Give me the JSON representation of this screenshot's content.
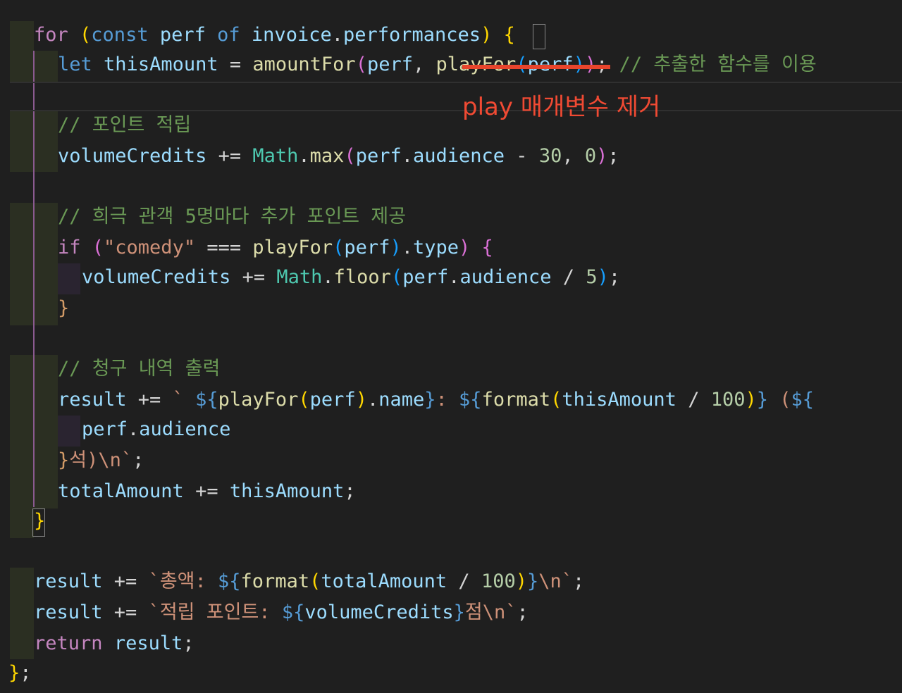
{
  "code": {
    "l1": [
      "for",
      " (",
      "const",
      " ",
      "perf",
      " ",
      "of",
      " ",
      "invoice",
      ".",
      "performances",
      ") ",
      "{"
    ],
    "l2": [
      "let",
      " ",
      "thisAmount",
      " = ",
      "amountFor",
      "(",
      "perf",
      ", ",
      "playFor",
      "(",
      "perf",
      ")",
      ")",
      "; ",
      "// 추출한 함수를 이용"
    ],
    "l3": [
      "// 포인트 적립"
    ],
    "l4": [
      "volumeCredits",
      " += ",
      "Math",
      ".",
      "max",
      "(",
      "perf",
      ".",
      "audience",
      " - ",
      "30",
      ", ",
      "0",
      ")",
      ";"
    ],
    "l5": [
      "// 희극 관객 5명마다 추가 포인트 제공"
    ],
    "l6": [
      "if",
      " (",
      "\"comedy\"",
      " === ",
      "playFor",
      "(",
      "perf",
      ")",
      ".",
      "type",
      ") ",
      "{"
    ],
    "l7": [
      "volumeCredits",
      " += ",
      "Math",
      ".",
      "floor",
      "(",
      "perf",
      ".",
      "audience",
      " / ",
      "5",
      ")",
      ";"
    ],
    "l8": [
      "}"
    ],
    "l9": [
      "// 청구 내역 출력"
    ],
    "l10": [
      "result",
      " += ",
      "` ",
      "${",
      "playFor",
      "(",
      "perf",
      ")",
      ".",
      "name",
      "}",
      ": ",
      "${",
      "format",
      "(",
      "thisAmount",
      " / ",
      "100",
      ")",
      "}",
      " (",
      "${"
    ],
    "l11": [
      "perf",
      ".",
      "audience"
    ],
    "l12": [
      "}",
      "석)\\n`",
      ";"
    ],
    "l13": [
      "totalAmount",
      " += ",
      "thisAmount",
      ";"
    ],
    "l14": [
      "}"
    ],
    "l15": [
      "result",
      " += ",
      "`총액: ",
      "${",
      "format",
      "(",
      "totalAmount",
      " / ",
      "100",
      ")",
      "}",
      "\\n`",
      ";"
    ],
    "l16": [
      "result",
      " += ",
      "`적립 포인트: ",
      "${",
      "volumeCredits",
      "}",
      "점\\n`",
      ";"
    ],
    "l17": [
      "return",
      " ",
      "result",
      ";"
    ],
    "l18": [
      "}",
      ";"
    ]
  },
  "annotation": {
    "note": "play 매개변수 제거"
  },
  "colors": {
    "background": "#1f1f1f",
    "keyword": "#c586c0",
    "storage": "#569cd6",
    "variable": "#9cdcfe",
    "function": "#dcdcaa",
    "class": "#4ec9b0",
    "string": "#ce9178",
    "number": "#b5cea8",
    "comment": "#6a9955",
    "annotation": "#f04a33"
  }
}
